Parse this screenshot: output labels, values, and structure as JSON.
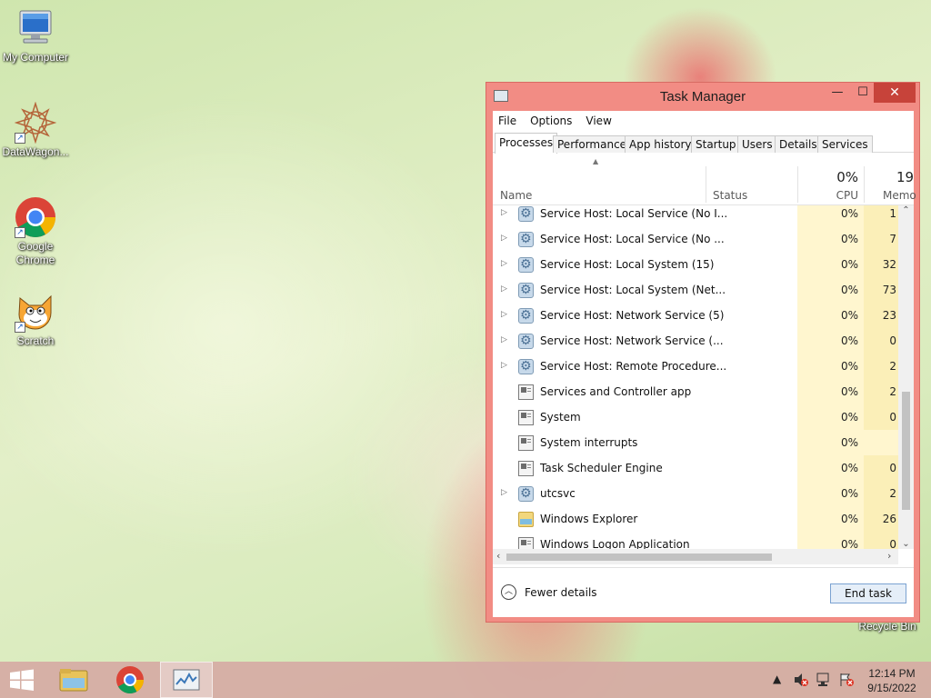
{
  "desktop": {
    "icons": [
      {
        "label": "My Computer",
        "icon": "computer-icon"
      },
      {
        "label": "DataWagon...",
        "icon": "datawagon-icon"
      },
      {
        "label": "Google Chrome",
        "icon": "chrome-icon"
      },
      {
        "label": "Scratch",
        "icon": "scratch-icon"
      },
      {
        "label": "Recycle Bin",
        "icon": "recycle-bin-icon"
      }
    ]
  },
  "task_manager": {
    "title": "Task Manager",
    "window_buttons": {
      "minimize": "—",
      "maximize": "☐",
      "close": "✕"
    },
    "menu": [
      "File",
      "Options",
      "View"
    ],
    "tabs": [
      "Processes",
      "Performance",
      "App history",
      "Startup",
      "Users",
      "Details",
      "Services"
    ],
    "active_tab": "Processes",
    "columns": {
      "name": "Name",
      "status": "Status",
      "cpu_header": "CPU",
      "cpu_total": "0%",
      "memory_header": "Memo",
      "memory_total": "19"
    },
    "processes": [
      {
        "name": "Service Host: Local Service (No I...",
        "cpu": "0%",
        "mem": "1",
        "expandable": true,
        "icon": "gear-icon"
      },
      {
        "name": "Service Host: Local Service (No ...",
        "cpu": "0%",
        "mem": "7",
        "expandable": true,
        "icon": "gear-icon"
      },
      {
        "name": "Service Host: Local System (15)",
        "cpu": "0%",
        "mem": "32",
        "expandable": true,
        "icon": "gear-icon"
      },
      {
        "name": "Service Host: Local System (Net...",
        "cpu": "0%",
        "mem": "73",
        "expandable": true,
        "icon": "gear-icon"
      },
      {
        "name": "Service Host: Network Service (5)",
        "cpu": "0%",
        "mem": "23",
        "expandable": true,
        "icon": "gear-icon"
      },
      {
        "name": "Service Host: Network Service (...",
        "cpu": "0%",
        "mem": "0",
        "expandable": true,
        "icon": "gear-icon"
      },
      {
        "name": "Service Host: Remote Procedure...",
        "cpu": "0%",
        "mem": "2",
        "expandable": true,
        "icon": "gear-icon"
      },
      {
        "name": "Services and Controller app",
        "cpu": "0%",
        "mem": "2",
        "expandable": false,
        "icon": "window-icon"
      },
      {
        "name": "System",
        "cpu": "0%",
        "mem": "0",
        "expandable": false,
        "icon": "window-icon"
      },
      {
        "name": "System interrupts",
        "cpu": "0%",
        "mem": "",
        "expandable": false,
        "icon": "window-icon"
      },
      {
        "name": "Task Scheduler Engine",
        "cpu": "0%",
        "mem": "0",
        "expandable": false,
        "icon": "window-icon"
      },
      {
        "name": "utcsvc",
        "cpu": "0%",
        "mem": "2",
        "expandable": true,
        "icon": "gear-icon"
      },
      {
        "name": "Windows Explorer",
        "cpu": "0%",
        "mem": "26",
        "expandable": false,
        "icon": "folder-icon"
      },
      {
        "name": "Windows Logon Application",
        "cpu": "0%",
        "mem": "0",
        "expandable": false,
        "icon": "window-icon"
      }
    ],
    "footer": {
      "fewer_details": "Fewer details",
      "end_task": "End task"
    }
  },
  "taskbar": {
    "items": [
      "start-icon",
      "file-explorer-icon",
      "chrome-icon",
      "task-manager-icon"
    ],
    "tray": [
      "show-hidden-icons-icon",
      "volume-muted-icon",
      "network-icon",
      "action-center-icon"
    ],
    "time": "12:14 PM",
    "date": "9/15/2022"
  }
}
